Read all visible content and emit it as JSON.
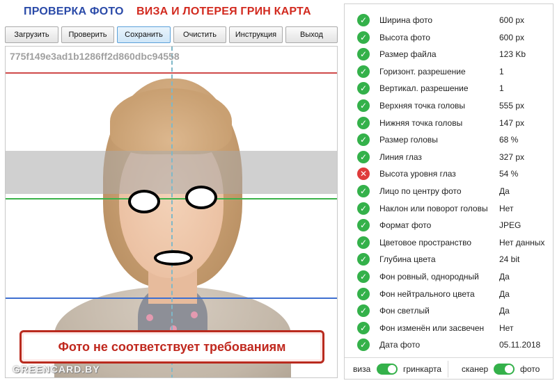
{
  "header": {
    "title_check": "ПРОВЕРКА ФОТО",
    "title_visa": "ВИЗА И ЛОТЕРЕЯ ГРИН КАРТА"
  },
  "toolbar": {
    "buttons": [
      "Загрузить",
      "Проверить",
      "Сохранить",
      "Очистить",
      "Инструкция",
      "Выход"
    ],
    "active": "Сохранить"
  },
  "photo": {
    "hash": "775f149e3ad1b1286ff2d860dbc94558",
    "warning": "Фото не соответствует требованиям",
    "watermark": "GREENCARD.BY"
  },
  "checks": [
    {
      "label": "Ширина фото",
      "value": "600 px",
      "status": "ok"
    },
    {
      "label": "Высота фото",
      "value": "600 px",
      "status": "ok"
    },
    {
      "label": "Размер файла",
      "value": "123 Kb",
      "status": "ok"
    },
    {
      "label": "Горизонт. разрешение",
      "value": "1",
      "status": "ok"
    },
    {
      "label": "Вертикал. разрешение",
      "value": "1",
      "status": "ok"
    },
    {
      "label": "Верхняя точка головы",
      "value": "555 px",
      "status": "ok"
    },
    {
      "label": "Нижняя точка головы",
      "value": "147 px",
      "status": "ok"
    },
    {
      "label": "Размер головы",
      "value": "68 %",
      "status": "ok"
    },
    {
      "label": "Линия глаз",
      "value": "327 px",
      "status": "ok"
    },
    {
      "label": "Высота уровня глаз",
      "value": "54 %",
      "status": "fail"
    },
    {
      "label": "Лицо по центру фото",
      "value": "Да",
      "status": "ok"
    },
    {
      "label": "Наклон или поворот головы",
      "value": "Нет",
      "status": "ok"
    },
    {
      "label": "Формат фото",
      "value": "JPEG",
      "status": "ok"
    },
    {
      "label": "Цветовое пространство",
      "value": "Нет данных",
      "status": "ok"
    },
    {
      "label": "Глубина цвета",
      "value": "24 bit",
      "status": "ok"
    },
    {
      "label": "Фон ровный, однородный",
      "value": "Да",
      "status": "ok"
    },
    {
      "label": "Фон нейтрального цвета",
      "value": "Да",
      "status": "ok"
    },
    {
      "label": "Фон светлый",
      "value": "Да",
      "status": "ok"
    },
    {
      "label": "Фон изменён или засвечен",
      "value": "Нет",
      "status": "ok"
    },
    {
      "label": "Дата фото",
      "value": "05.11.2018",
      "status": "ok"
    }
  ],
  "switches": {
    "mode_left": "виза",
    "mode_right": "гринкарта",
    "mode_on": true,
    "source_left": "сканер",
    "source_right": "фото",
    "source_on": true
  },
  "colors": {
    "ok": "#34b14a",
    "fail": "#df3b3b",
    "title_blue": "#2a4aa8",
    "title_red": "#d22a1f"
  },
  "icons": {
    "ok": "check-icon",
    "fail": "cross-icon"
  }
}
